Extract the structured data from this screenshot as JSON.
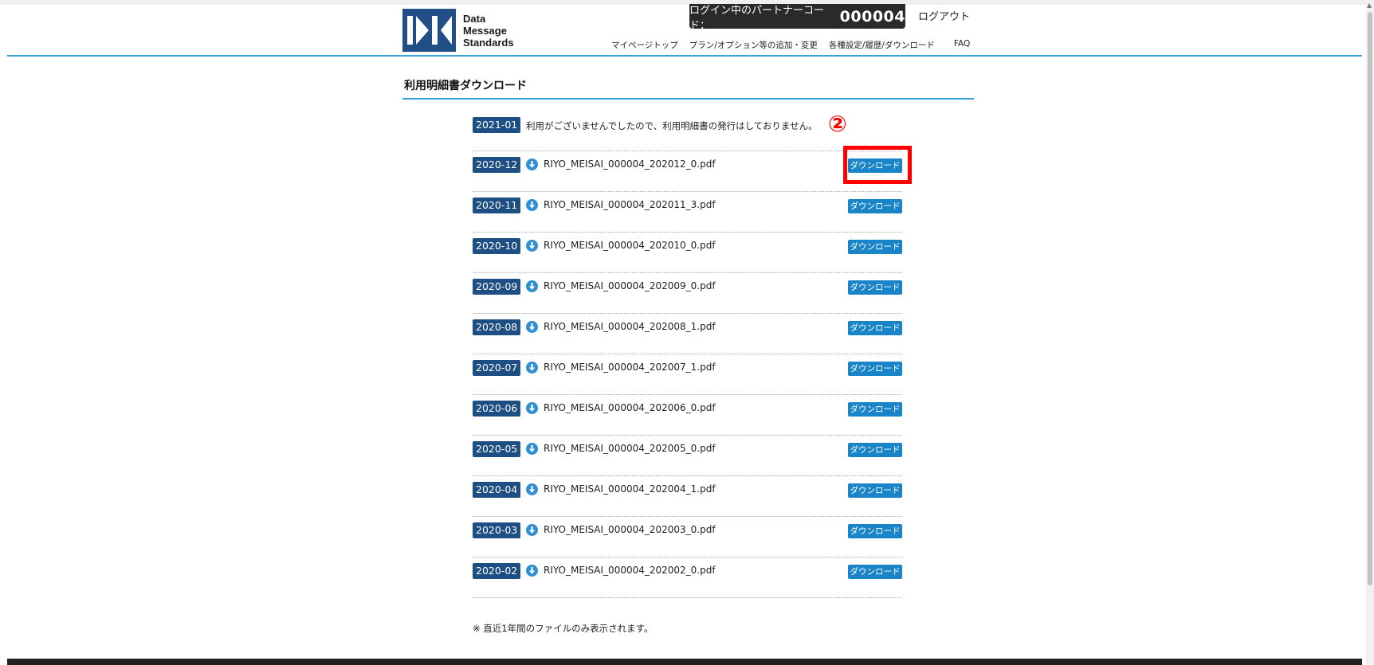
{
  "header": {
    "logo_lines": [
      "Data",
      "Message",
      "Standards"
    ],
    "partner_label": "ログイン中のパートナーコード：",
    "partner_code": "000004",
    "logout": "ログアウト",
    "nav": [
      "マイページトップ",
      "プラン/オプション等の追加・変更",
      "各種設定/履歴/ダウンロード",
      "FAQ"
    ]
  },
  "page": {
    "title": "利用明細書ダウンロード",
    "step_marker": "②",
    "footnote": "※ 直近1年間のファイルのみ表示されます。"
  },
  "statements": [
    {
      "month": "2021-01",
      "notice": "利用がございませんでしたので、利用明細書の発行はしておりません。"
    },
    {
      "month": "2020-12",
      "file": "RIYO_MEISAI_000004_202012_0.pdf",
      "button": "ダウンロード"
    },
    {
      "month": "2020-11",
      "file": "RIYO_MEISAI_000004_202011_3.pdf",
      "button": "ダウンロード"
    },
    {
      "month": "2020-10",
      "file": "RIYO_MEISAI_000004_202010_0.pdf",
      "button": "ダウンロード"
    },
    {
      "month": "2020-09",
      "file": "RIYO_MEISAI_000004_202009_0.pdf",
      "button": "ダウンロード"
    },
    {
      "month": "2020-08",
      "file": "RIYO_MEISAI_000004_202008_1.pdf",
      "button": "ダウンロード"
    },
    {
      "month": "2020-07",
      "file": "RIYO_MEISAI_000004_202007_1.pdf",
      "button": "ダウンロード"
    },
    {
      "month": "2020-06",
      "file": "RIYO_MEISAI_000004_202006_0.pdf",
      "button": "ダウンロード"
    },
    {
      "month": "2020-05",
      "file": "RIYO_MEISAI_000004_202005_0.pdf",
      "button": "ダウンロード"
    },
    {
      "month": "2020-04",
      "file": "RIYO_MEISAI_000004_202004_1.pdf",
      "button": "ダウンロード"
    },
    {
      "month": "2020-03",
      "file": "RIYO_MEISAI_000004_202003_0.pdf",
      "button": "ダウンロード"
    },
    {
      "month": "2020-02",
      "file": "RIYO_MEISAI_000004_202002_0.pdf",
      "button": "ダウンロード"
    }
  ],
  "colors": {
    "accent": "#3aa0d8",
    "badge": "#1d4e84",
    "button": "#1a84c8",
    "highlight": "#ff0000"
  }
}
